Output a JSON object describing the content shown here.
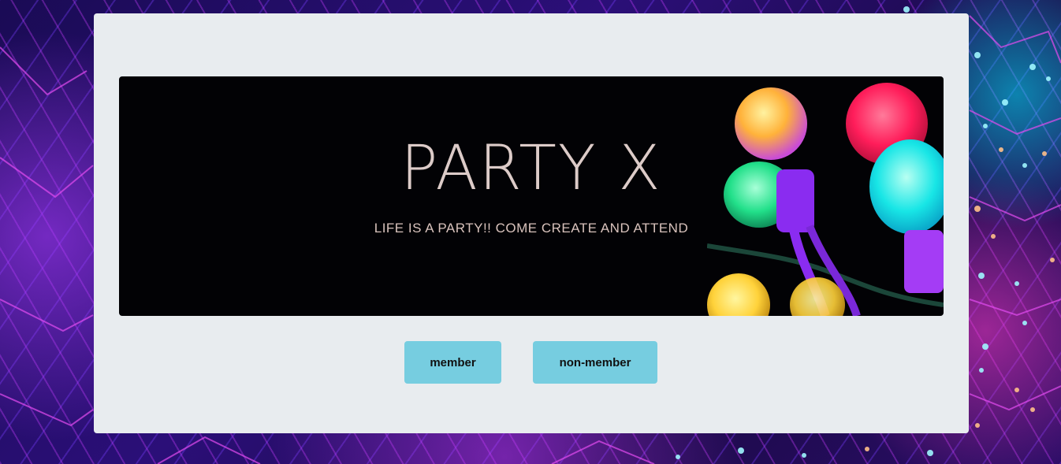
{
  "hero": {
    "title": "PARTY X",
    "subtitle": "LIFE IS A PARTY!! COME CREATE AND ATTEND"
  },
  "buttons": {
    "member_label": "member",
    "non_member_label": "non-member"
  },
  "colors": {
    "panel_bg": "#e8ecef",
    "hero_bg": "#020205",
    "button_bg": "#76cde0",
    "title_text": "#dccbc8"
  }
}
